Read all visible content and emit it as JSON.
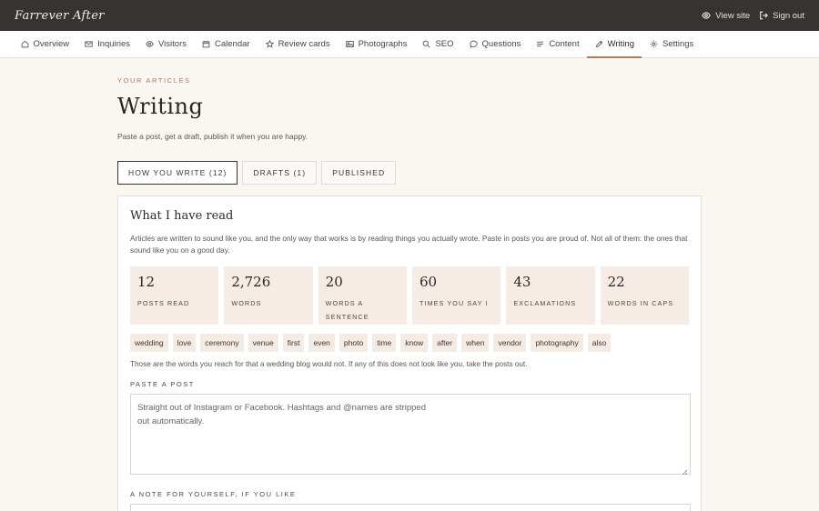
{
  "app": {
    "brand": "Farrever After",
    "view_site": "View site",
    "sign_out": "Sign out"
  },
  "nav": {
    "items": [
      {
        "label": "Overview",
        "icon": "home-icon"
      },
      {
        "label": "Inquiries",
        "icon": "mail-icon"
      },
      {
        "label": "Visitors",
        "icon": "eye-icon"
      },
      {
        "label": "Calendar",
        "icon": "calendar-icon"
      },
      {
        "label": "Review cards",
        "icon": "star-icon"
      },
      {
        "label": "Photographs",
        "icon": "image-icon"
      },
      {
        "label": "SEO",
        "icon": "search-icon"
      },
      {
        "label": "Questions",
        "icon": "chat-icon"
      },
      {
        "label": "Content",
        "icon": "lines-icon"
      },
      {
        "label": "Writing",
        "icon": "pencil-icon",
        "active": true
      },
      {
        "label": "Settings",
        "icon": "gear-icon"
      }
    ]
  },
  "page": {
    "eyebrow": "Your articles",
    "title": "Writing",
    "subtitle": "Paste a post, get a draft, publish it when you are happy."
  },
  "tabs": [
    {
      "label": "How you write (12)",
      "active": true
    },
    {
      "label": "Drafts (1)"
    },
    {
      "label": "Published"
    }
  ],
  "card": {
    "title": "What I have read",
    "description": "Articles are written to sound like you, and the only way that works is by reading things you actually wrote. Paste in posts you are proud of. Not all of them: the ones that sound like you on a good day.",
    "stats": [
      {
        "value": "12",
        "label": "Posts read"
      },
      {
        "value": "2,726",
        "label": "Words"
      },
      {
        "value": "20",
        "label": "Words a sentence"
      },
      {
        "value": "60",
        "label": "Times you say I"
      },
      {
        "value": "43",
        "label": "Exclamations"
      },
      {
        "value": "22",
        "label": "Words in caps"
      }
    ],
    "chips": [
      "wedding",
      "love",
      "ceremony",
      "venue",
      "first",
      "even",
      "photo",
      "time",
      "know",
      "after",
      "when",
      "vendor",
      "photography",
      "also"
    ],
    "chips_note": "Those are the words you reach for that a wedding blog would not. If any of this does not look like you, take the posts out.",
    "paste_label": "Paste a post",
    "paste_placeholder": "Straight out of Instagram or Facebook. Hashtags and @names are stripped\nout automatically.",
    "note_label": "A note for yourself, if you like"
  },
  "colors": {
    "topbar": "#363433",
    "accent": "#b07a5e",
    "background": "#faf6f2",
    "stat_bg": "#f6ece5"
  }
}
